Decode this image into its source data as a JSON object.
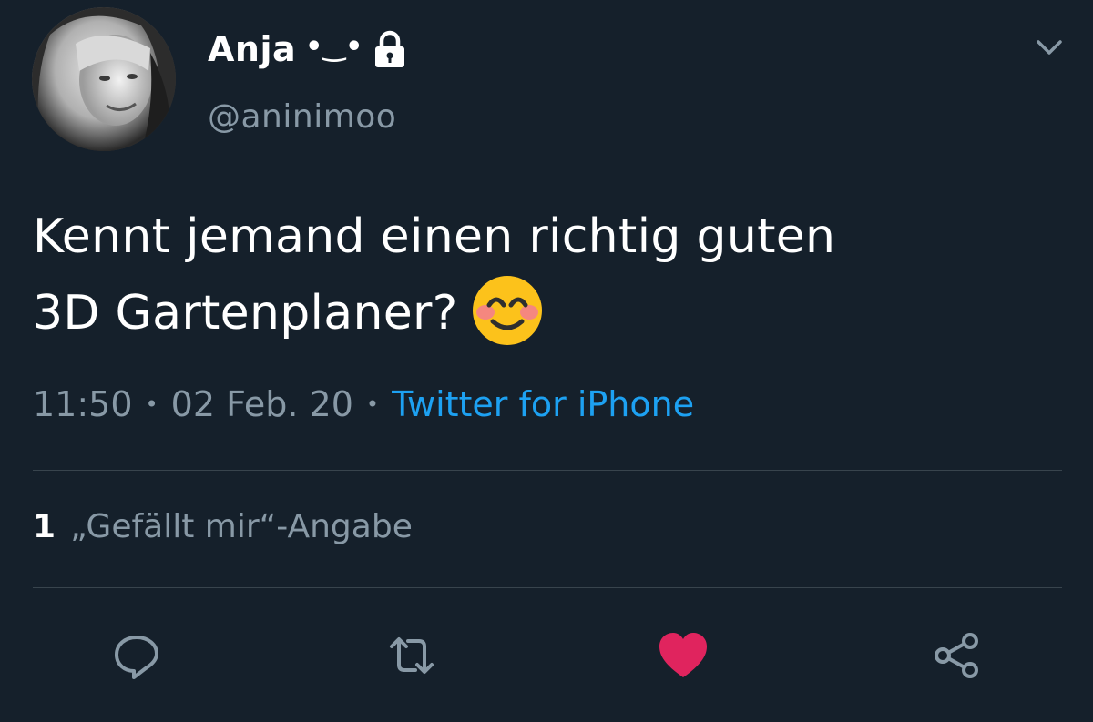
{
  "author": {
    "display_name": "Anja",
    "emoticon": "•‿•",
    "handle": "@aninimoo",
    "protected_icon": "lock-icon"
  },
  "tweet": {
    "text_line1": "Kennt jemand einen richtig guten",
    "text_line2": "3D Gartenplaner?",
    "emoji": "smiling-face-with-smiling-eyes-emoji"
  },
  "meta": {
    "time": "11:50",
    "separator": "•",
    "date": "02 Feb. 20",
    "source": "Twitter for iPhone"
  },
  "engagement": {
    "likes_count": "1",
    "likes_label": "„Gefällt mir“-Angabe"
  },
  "actions": [
    {
      "name": "reply",
      "icon": "reply-icon"
    },
    {
      "name": "retweet",
      "icon": "retweet-icon"
    },
    {
      "name": "like",
      "icon": "heart-icon",
      "active": true
    },
    {
      "name": "share",
      "icon": "share-icon"
    }
  ],
  "colors": {
    "background": "#15202b",
    "text_primary": "#ffffff",
    "text_secondary": "#8899a6",
    "accent": "#1da1f2",
    "like": "#e0245e",
    "divider": "#38444d"
  }
}
